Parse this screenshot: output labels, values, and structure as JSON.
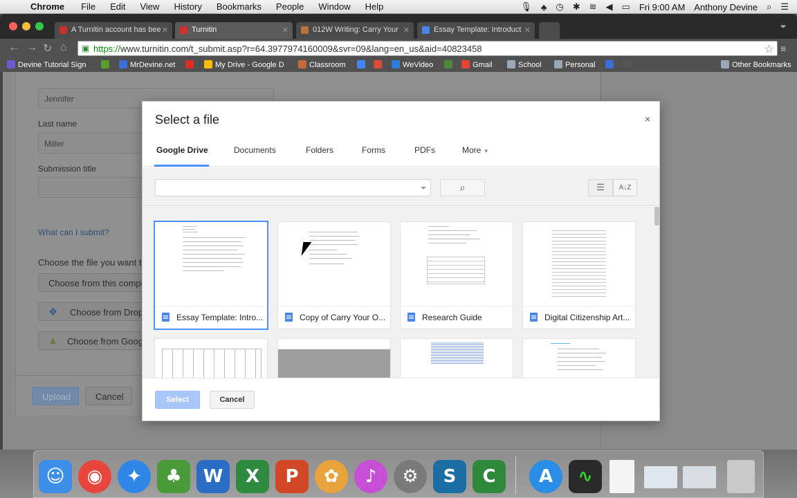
{
  "menubar": {
    "apple": "",
    "app": "Chrome",
    "items": [
      "File",
      "Edit",
      "View",
      "History",
      "Bookmarks",
      "People",
      "Window",
      "Help"
    ],
    "clock": "Fri 9:00 AM",
    "user": "Anthony Devine"
  },
  "tabs": [
    {
      "title": "A Turnitin account has bee",
      "icon_color": "#c7322b"
    },
    {
      "title": "Turnitin",
      "icon_color": "#d0312d"
    },
    {
      "title": "012W Writing: Carry Your",
      "icon_color": "#b8733a"
    },
    {
      "title": "Essay Template: Introduct",
      "icon_color": "#4a86e8"
    }
  ],
  "omnibox": {
    "scheme": "https://",
    "rest": "www.turnitin.com/t_submit.asp?r=64.3977974160009&svr=09&lang=en_us&aid=40823458"
  },
  "bookmarks": [
    {
      "label": "Devine Tutorial Sign",
      "color": "#6a5acd"
    },
    {
      "label": "",
      "color": "#5a9e2f"
    },
    {
      "label": "MrDevine.net",
      "color": "#3b6fd4"
    },
    {
      "label": "",
      "color": "#d93025"
    },
    {
      "label": "My Drive - Google D",
      "color": "#fbbc05"
    },
    {
      "label": "Classroom",
      "color": "#c6693b"
    },
    {
      "label": "",
      "color": "#4285f4"
    },
    {
      "label": "",
      "color": "#dd4b39"
    },
    {
      "label": "WeVideo",
      "color": "#2f7bd9"
    },
    {
      "label": "",
      "color": "#4c8a3a"
    },
    {
      "label": "Gmail",
      "color": "#ea4335"
    },
    {
      "label": "School",
      "color": "#9aa7b5"
    },
    {
      "label": "Personal",
      "color": "#9aa7b5"
    },
    {
      "label": "",
      "color": "#3b6fd4"
    },
    {
      "label": "",
      "color": "#555"
    }
  ],
  "other_bookmarks": "Other Bookmarks",
  "form": {
    "first_name_value": "Jennifer",
    "last_name_label": "Last name",
    "last_name_value": "Miller",
    "submission_title_label": "Submission title",
    "what_link": "What can I submit?",
    "choose_label": "Choose the file you want to",
    "choose_computer": "Choose from this compu",
    "choose_dropbox": "Choose from Dropb",
    "choose_google": "Choose from Googl",
    "upload": "Upload",
    "cancel": "Cancel"
  },
  "dialog": {
    "title": "Select a file",
    "close": "×",
    "tabs": [
      "Google Drive",
      "Documents",
      "Folders",
      "Forms",
      "PDFs",
      "More"
    ],
    "active_tab": "Google Drive",
    "files": [
      {
        "name": "Essay Template: Intro...",
        "selected": true
      },
      {
        "name": "Copy of Carry Your O...",
        "selected": false
      },
      {
        "name": "Research Guide",
        "selected": false
      },
      {
        "name": "Digital Citizenship Art...",
        "selected": false
      }
    ],
    "select_btn": "Select",
    "cancel_btn": "Cancel"
  },
  "dock": [
    {
      "name": "finder",
      "color": "#3d8ee6",
      "glyph": "☺"
    },
    {
      "name": "chrome",
      "color": "#e8453c",
      "glyph": "◉"
    },
    {
      "name": "safari",
      "color": "#2f86e6",
      "glyph": "✦"
    },
    {
      "name": "evernote",
      "color": "#4a9a3a",
      "glyph": "♣"
    },
    {
      "name": "word",
      "color": "#2b6cc4",
      "glyph": "W"
    },
    {
      "name": "excel",
      "color": "#2d8a3e",
      "glyph": "X"
    },
    {
      "name": "powerpoint",
      "color": "#d24726",
      "glyph": "P"
    },
    {
      "name": "photos",
      "color": "#e8a33c",
      "glyph": "✿"
    },
    {
      "name": "itunes",
      "color": "#c64fd6",
      "glyph": "♪"
    },
    {
      "name": "system-prefs",
      "color": "#7a7a7a",
      "glyph": "⚙"
    },
    {
      "name": "snagit",
      "color": "#1a6ea3",
      "glyph": "S"
    },
    {
      "name": "camtasia",
      "color": "#2e8a3a",
      "glyph": "C"
    },
    {
      "name": "app-store",
      "color": "#2a8de6",
      "glyph": "A"
    },
    {
      "name": "activity-monitor",
      "color": "#2a2a2a",
      "glyph": "∿"
    },
    {
      "name": "document",
      "color": "#f4f4f4",
      "glyph": ""
    },
    {
      "name": "screenshot-1",
      "color": "#dfe6ee",
      "glyph": ""
    },
    {
      "name": "screenshot-2",
      "color": "#d8dde2",
      "glyph": ""
    },
    {
      "name": "trash",
      "color": "#c9c9c9",
      "glyph": "🗑"
    }
  ]
}
